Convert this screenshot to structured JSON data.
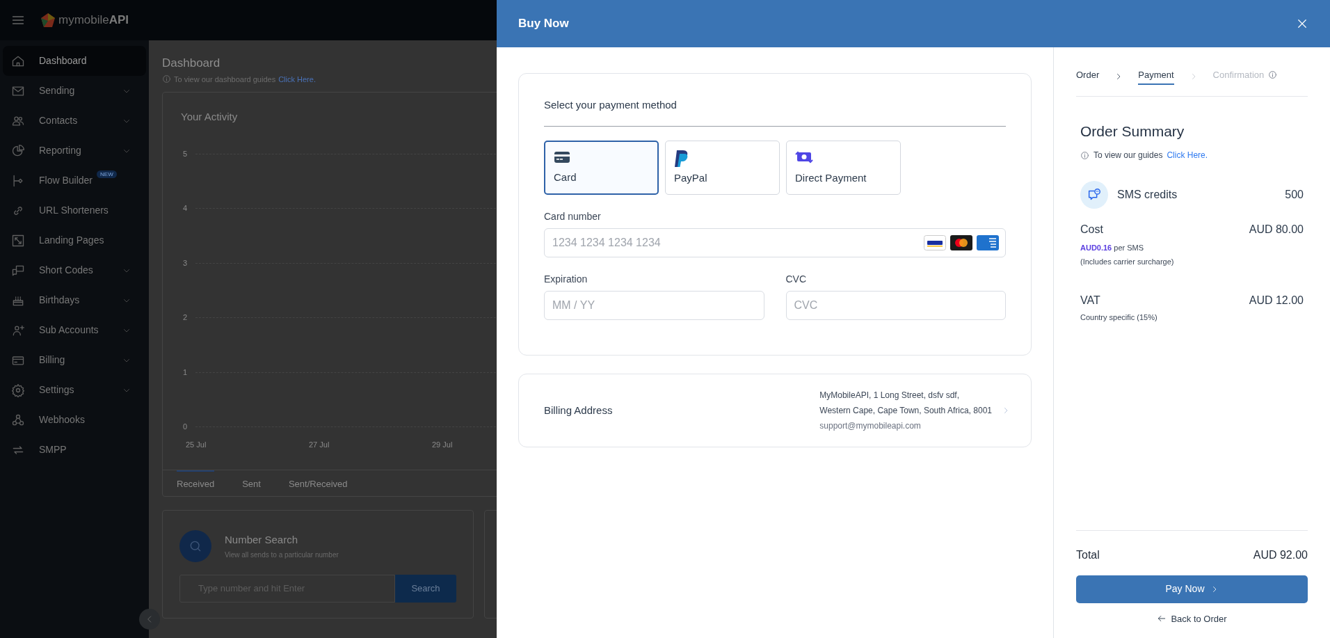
{
  "app": {
    "brand": "mymobile",
    "brand_bold": "API"
  },
  "sidebar": {
    "items": [
      {
        "label": "Dashboard",
        "selected": true,
        "has_submenu": false
      },
      {
        "label": "Sending",
        "selected": false,
        "has_submenu": true
      },
      {
        "label": "Contacts",
        "selected": false,
        "has_submenu": true
      },
      {
        "label": "Reporting",
        "selected": false,
        "has_submenu": true
      },
      {
        "label": "Flow Builder",
        "selected": false,
        "has_submenu": false,
        "badge": "NEW"
      },
      {
        "label": "URL Shorteners",
        "selected": false,
        "has_submenu": false
      },
      {
        "label": "Landing Pages",
        "selected": false,
        "has_submenu": false
      },
      {
        "label": "Short Codes",
        "selected": false,
        "has_submenu": true
      },
      {
        "label": "Birthdays",
        "selected": false,
        "has_submenu": true
      },
      {
        "label": "Sub Accounts",
        "selected": false,
        "has_submenu": true
      },
      {
        "label": "Billing",
        "selected": false,
        "has_submenu": true
      },
      {
        "label": "Settings",
        "selected": false,
        "has_submenu": true
      },
      {
        "label": "Webhooks",
        "selected": false,
        "has_submenu": false
      },
      {
        "label": "SMPP",
        "selected": false,
        "has_submenu": false
      }
    ]
  },
  "dashboard": {
    "title": "Dashboard",
    "hint": "To view our dashboard guides",
    "hint_link": "Click Here.",
    "activity": {
      "title": "Your Activity",
      "y_ticks": [
        "5",
        "4",
        "3",
        "2",
        "1",
        "0"
      ],
      "x_labels": [
        "25 Jul",
        "27 Jul",
        "29 Jul"
      ],
      "tabs": [
        {
          "label": "Received",
          "selected": true
        },
        {
          "label": "Sent",
          "selected": false
        },
        {
          "label": "Sent/Received",
          "selected": false
        }
      ]
    },
    "number_search": {
      "title": "Number Search",
      "subtitle": "View all sends to a particular number",
      "placeholder": "Type number and hit Enter",
      "button": "Search"
    }
  },
  "modal": {
    "title": "Buy Now",
    "payment": {
      "heading": "Select your payment method",
      "methods": [
        {
          "kind": "card",
          "label": "Card",
          "selected": true
        },
        {
          "kind": "paypal",
          "label": "PayPal",
          "selected": false
        },
        {
          "kind": "direct",
          "label": "Direct Payment",
          "selected": false
        }
      ],
      "card_number": {
        "label": "Card number",
        "placeholder": "1234 1234 1234 1234"
      },
      "expiration": {
        "label": "Expiration",
        "placeholder": "MM / YY"
      },
      "cvc": {
        "label": "CVC",
        "placeholder": "CVC"
      }
    },
    "billing": {
      "label": "Billing Address",
      "lines": [
        "MyMobileAPI, 1 Long Street, dsfv sdf,",
        "Western Cape, Cape Town, South Africa, 8001"
      ],
      "email": "support@mymobileapi.com"
    },
    "steps": [
      {
        "label": "Order",
        "selected": false,
        "disabled": false,
        "info": false
      },
      {
        "label": "Payment",
        "selected": true,
        "disabled": false,
        "info": false
      },
      {
        "label": "Confirmation",
        "selected": false,
        "disabled": true,
        "info": true
      }
    ],
    "summary": {
      "title": "Order Summary",
      "hint": "To view our guides",
      "hint_link": "Click Here.",
      "product": {
        "name": "SMS credits",
        "quantity": "500"
      },
      "cost": {
        "label": "Cost",
        "amount": "AUD 80.00",
        "rate": "**AUD0.16** per SMS",
        "note": "(Includes carrier surcharge)"
      },
      "vat": {
        "label": "VAT",
        "amount": "AUD 12.00",
        "note": "Country specific (15%)"
      },
      "total": {
        "label": "Total",
        "amount": "AUD 92.00"
      },
      "pay_button": "Pay Now",
      "back_link": "Back to Order"
    }
  }
}
